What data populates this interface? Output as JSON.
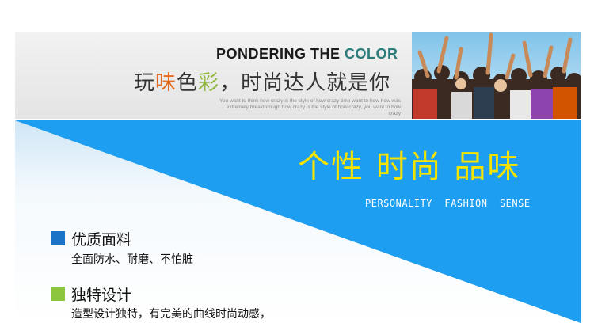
{
  "banner": {
    "headline_main": "PONDERING THE ",
    "headline_accent": "COLOR",
    "tagline_chars": [
      {
        "char": "玩",
        "color": "#333333"
      },
      {
        "char": "味",
        "color": "#e46b1d"
      },
      {
        "char": "色",
        "color": "#333333"
      },
      {
        "char": "彩",
        "color": "#8fb73d"
      },
      {
        "char": "，",
        "color": "#333333"
      },
      {
        "char": "时",
        "color": "#333333"
      },
      {
        "char": "尚",
        "color": "#333333"
      },
      {
        "char": "达",
        "color": "#333333"
      },
      {
        "char": "人",
        "color": "#333333"
      },
      {
        "char": "就",
        "color": "#333333"
      },
      {
        "char": "是",
        "color": "#333333"
      },
      {
        "char": "你",
        "color": "#333333"
      }
    ],
    "small_english": "You want to think how crazy is the style of how crazy time want to how how was extremely breakthrough how crazy is the style of how crazy, you want to how crazy"
  },
  "hero": {
    "title": "个性 时尚 品味",
    "subtitle": "PERSONALITY  FASHION  SENSE",
    "colors": {
      "blue": "#1e9ef0",
      "yellow": "#f5e300"
    }
  },
  "features": [
    {
      "title": "优质面料",
      "description": "全面防水、耐磨、不怕脏",
      "color": "#1a73c6"
    },
    {
      "title": "独特设计",
      "description": "造型设计独特，有完美的曲线时尚动感，",
      "color": "#8cc63f"
    }
  ]
}
